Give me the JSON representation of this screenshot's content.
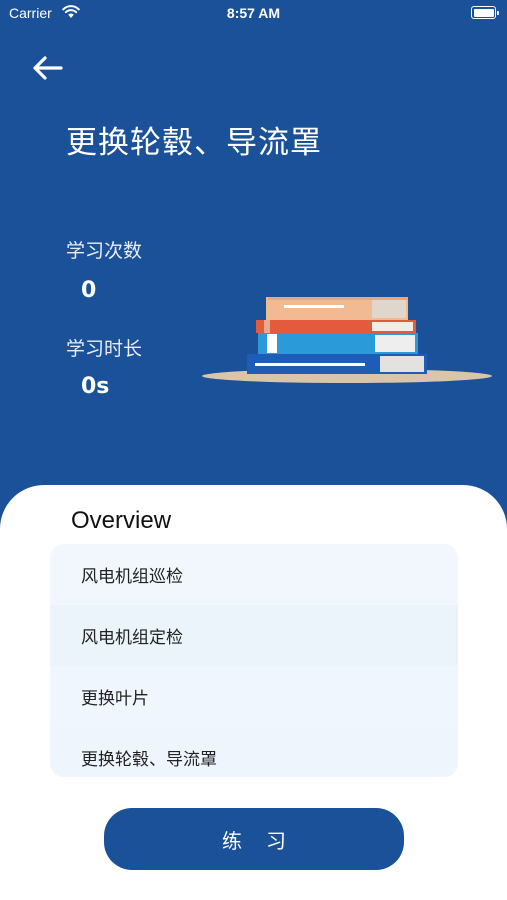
{
  "status_bar": {
    "carrier": "Carrier",
    "time": "8:57 AM"
  },
  "header": {
    "title": "更换轮毂、导流罩"
  },
  "stats": {
    "count_label": "学习次数",
    "count_value": "0",
    "duration_label": "学习时长",
    "duration_value": "0s"
  },
  "overview": {
    "title": "Overview",
    "items": [
      {
        "label": "风电机组巡检"
      },
      {
        "label": "风电机组定检"
      },
      {
        "label": "更换叶片"
      },
      {
        "label": "更换轮毂、导流罩"
      }
    ]
  },
  "practice_button": {
    "label": "练习"
  },
  "colors": {
    "primary": "#1a5198",
    "sheet": "#ffffff",
    "list_bg": "#f0f6fd"
  }
}
